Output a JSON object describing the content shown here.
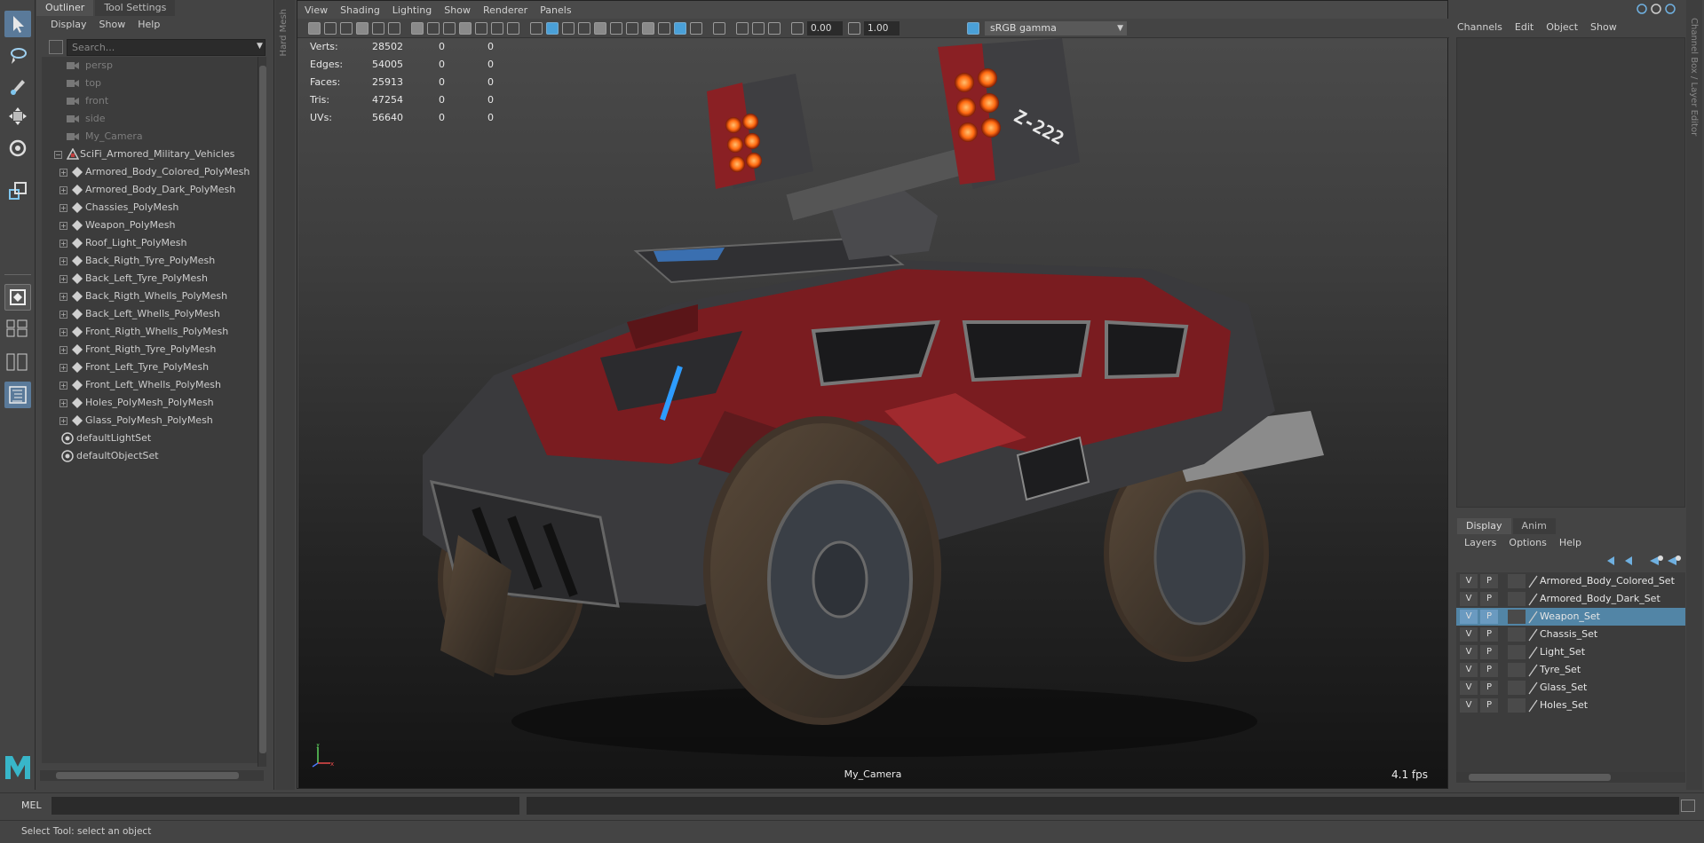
{
  "outliner": {
    "tabs": [
      "Outliner",
      "Tool Settings"
    ],
    "menu": [
      "Display",
      "Show",
      "Help"
    ],
    "search_placeholder": "Search...",
    "cameras": [
      "persp",
      "top",
      "front",
      "side",
      "My_Camera"
    ],
    "group": "SciFi_Armored_Military_Vehicles",
    "meshes": [
      "Armored_Body_Colored_PolyMesh",
      "Armored_Body_Dark_PolyMesh",
      "Chassies_PolyMesh",
      "Weapon_PolyMesh",
      "Roof_Light_PolyMesh",
      "Back_Rigth_Tyre_PolyMesh",
      "Back_Left_Tyre_PolyMesh",
      "Back_Rigth_Whells_PolyMesh",
      "Back_Left_Whells_PolyMesh",
      "Front_Rigth_Whells_PolyMesh",
      "Front_Rigth_Tyre_PolyMesh",
      "Front_Left_Tyre_PolyMesh",
      "Front_Left_Whells_PolyMesh",
      "Holes_PolyMesh_PolyMesh",
      "Glass_PolyMesh_PolyMesh"
    ],
    "sets": [
      "defaultLightSet",
      "defaultObjectSet"
    ]
  },
  "side_strip_label": "Hard Mesh",
  "viewport": {
    "menu": [
      "View",
      "Shading",
      "Lighting",
      "Show",
      "Renderer",
      "Panels"
    ],
    "exposure": "0.00",
    "gamma": "1.00",
    "color_space": "sRGB gamma",
    "hud": [
      {
        "label": "Verts:",
        "values": [
          "28502",
          "0",
          "0"
        ]
      },
      {
        "label": "Edges:",
        "values": [
          "54005",
          "0",
          "0"
        ]
      },
      {
        "label": "Faces:",
        "values": [
          "25913",
          "0",
          "0"
        ]
      },
      {
        "label": "Tris:",
        "values": [
          "47254",
          "0",
          "0"
        ]
      },
      {
        "label": "UVs:",
        "values": [
          "56640",
          "0",
          "0"
        ]
      }
    ],
    "camera": "My_Camera",
    "fps": "4.1 fps",
    "decal_text": "Z-222"
  },
  "channel_box": {
    "menu": [
      "Channels",
      "Edit",
      "Object",
      "Show"
    ]
  },
  "right_strip_label": "Channel Box / Layer Editor",
  "layer_editor": {
    "tabs": [
      "Display",
      "Anim"
    ],
    "menu": [
      "Layers",
      "Options",
      "Help"
    ],
    "layers": [
      {
        "v": "V",
        "p": "P",
        "name": "Armored_Body_Colored_Set",
        "selected": false
      },
      {
        "v": "V",
        "p": "P",
        "name": "Armored_Body_Dark_Set",
        "selected": false
      },
      {
        "v": "V",
        "p": "P",
        "name": "Weapon_Set",
        "selected": true
      },
      {
        "v": "V",
        "p": "P",
        "name": "Chassis_Set",
        "selected": false
      },
      {
        "v": "V",
        "p": "P",
        "name": "Light_Set",
        "selected": false
      },
      {
        "v": "V",
        "p": "P",
        "name": "Tyre_Set",
        "selected": false
      },
      {
        "v": "V",
        "p": "P",
        "name": "Glass_Set",
        "selected": false
      },
      {
        "v": "V",
        "p": "P",
        "name": "Holes_Set",
        "selected": false
      }
    ]
  },
  "command_line": {
    "label": "MEL"
  },
  "help_line": "Select Tool: select an object",
  "colors": {
    "accent": "#5285a6",
    "tool_active": "#5a7a9a",
    "maya_logo": "#38b6c9",
    "vehicle_red": "#8a1f22",
    "light_orange": "#ff7a1a"
  },
  "icons": {
    "tools": [
      "select-arrow-icon",
      "lasso-icon",
      "paint-select-icon",
      "move-icon",
      "rotate-icon",
      "scale-icon"
    ]
  }
}
